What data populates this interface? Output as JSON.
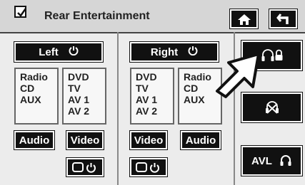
{
  "header": {
    "title": "Rear Entertainment",
    "home_icon": "home-icon",
    "back_icon": "back-arrow-icon"
  },
  "left": {
    "label": "Left",
    "sources_a": [
      "Radio",
      "CD",
      "AUX"
    ],
    "sources_b": [
      "DVD",
      "TV",
      "AV 1",
      "AV 2"
    ],
    "audio_label": "Audio",
    "video_label": "Video"
  },
  "right": {
    "label": "Right",
    "sources_a": [
      "DVD",
      "TV",
      "AV 1",
      "AV 2"
    ],
    "sources_b": [
      "Radio",
      "CD",
      "AUX"
    ],
    "video_label": "Video",
    "audio_label": "Audio"
  },
  "side": {
    "avl_label": "AVL",
    "lock_icon": "headphone-lock-icon",
    "mute_icon": "headphone-mute-icon",
    "headphone_icon": "headphone-icon"
  },
  "colors": {
    "button": "#111111",
    "panel": "#ececec",
    "header": "#d6d6d6"
  }
}
